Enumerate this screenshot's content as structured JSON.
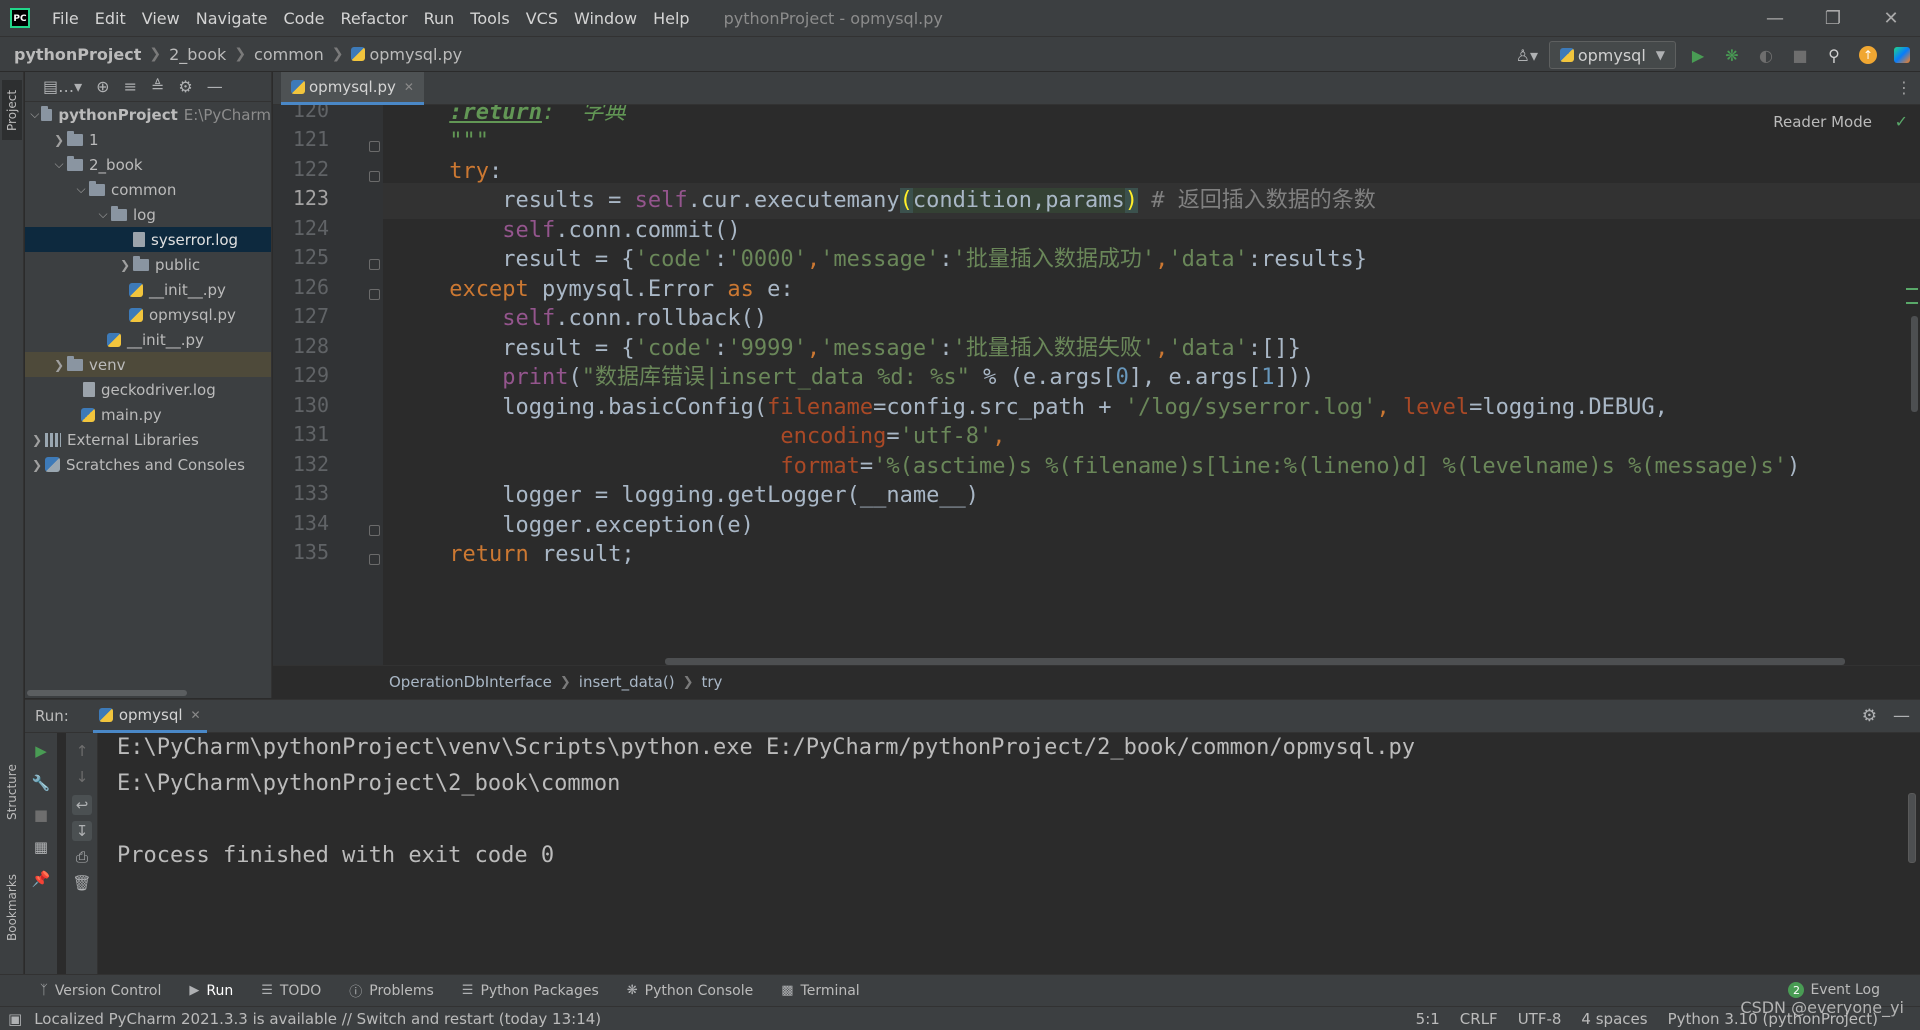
{
  "menu": {
    "items": [
      "File",
      "Edit",
      "View",
      "Navigate",
      "Code",
      "Refactor",
      "Run",
      "Tools",
      "VCS",
      "Window",
      "Help"
    ],
    "window_title": "pythonProject - opmysql.py"
  },
  "navbar": {
    "crumbs": [
      "pythonProject",
      "2_book",
      "common",
      "opmysql.py"
    ],
    "run_config": "opmysql"
  },
  "sidebar_tabs": {
    "project": "Project",
    "structure": "Structure",
    "bookmarks": "Bookmarks"
  },
  "project": {
    "root_name": "pythonProject",
    "root_path": "E:\\PyCharm",
    "items": [
      "1",
      "2_book",
      "common",
      "log",
      "syserror.log",
      "public",
      "__init__.py",
      "opmysql.py",
      "__init__.py",
      "venv",
      "geckodriver.log",
      "main.py",
      "External Libraries",
      "Scratches and Consoles"
    ]
  },
  "editor": {
    "tab_label": "opmysql.py",
    "reader_mode": "Reader Mode",
    "line_numbers": [
      "120",
      "121",
      "122",
      "123",
      "124",
      "125",
      "126",
      "127",
      "128",
      "129",
      "130",
      "131",
      "132",
      "133",
      "134",
      "135"
    ],
    "breadcrumb": [
      "OperationDbInterface",
      "insert_data()",
      "try"
    ],
    "code": {
      "l120_tag": ":return",
      "l120_text": ":  字典",
      "l121": "\"\"\"",
      "l122_kw": "try",
      "l122_p": ":",
      "l123_a": "results = ",
      "l123_self": "self",
      "l123_b": ".cur.executemany",
      "l123_open": "(",
      "l123_args": "condition,params",
      "l123_close": ")",
      "l123_cmt": " # 返回插入数据的条数",
      "l124_self": "self",
      "l124_b": ".conn.commit()",
      "l125_a": "result = {",
      "l125_k1": "'code'",
      "l125_c1": ":",
      "l125_v1": "'0000'",
      "l125_c2": ",",
      "l125_k2": "'message'",
      "l125_c3": ":",
      "l125_v2": "'批量插入数据成功'",
      "l125_c4": ",",
      "l125_k3": "'data'",
      "l125_c5": ":results}",
      "l126_kw": "except",
      "l126_b": " pymysql.Error ",
      "l126_as": "as",
      "l126_c": " e:",
      "l127_self": "self",
      "l127_b": ".conn.rollback()",
      "l128_a": "result = {",
      "l128_k1": "'code'",
      "l128_c1": ":",
      "l128_v1": "'9999'",
      "l128_c2": ",",
      "l128_k2": "'message'",
      "l128_c3": ":",
      "l128_v2": "'批量插入数据失败'",
      "l128_c4": ",",
      "l128_k3": "'data'",
      "l128_c5": ":[]}",
      "l129_print": "print",
      "l129_open": "(",
      "l129_str": "\"数据库错误|insert_data %d: %s\"",
      "l129_b": " % (e.args[",
      "l129_n0": "0",
      "l129_c": "], e.args[",
      "l129_n1": "1",
      "l129_d": "]))",
      "l130_a": "logging.basicConfig(",
      "l130_kw1": "filename",
      "l130_b": "=config.src_path + ",
      "l130_s1": "'/log/syserror.log'",
      "l130_c": ", ",
      "l130_kw2": "level",
      "l130_d": "=logging.DEBUG,",
      "l131_kw": "encoding",
      "l131_eq": "=",
      "l131_s": "'utf-8'",
      "l131_c": ",",
      "l132_kw": "format",
      "l132_eq": "=",
      "l132_s": "'%(asctime)s %(filename)s[line:%(lineno)d] %(levelname)s %(message)s'",
      "l132_c": ")",
      "l133": "logger = logging.getLogger(__name__)",
      "l134": "logger.exception(e)",
      "l135_kw": "return",
      "l135_b": " result;"
    }
  },
  "run": {
    "label": "Run:",
    "tab": "opmysql",
    "console": [
      "E:\\PyCharm\\pythonProject\\venv\\Scripts\\python.exe E:/PyCharm/pythonProject/2_book/common/opmysql.py",
      "E:\\PyCharm\\pythonProject\\2_book\\common",
      "Process finished with exit code 0"
    ]
  },
  "toolwindows": [
    "Version Control",
    "Run",
    "TODO",
    "Problems",
    "Python Packages",
    "Python Console",
    "Terminal"
  ],
  "event_log": {
    "label": "Event Log",
    "count": "2"
  },
  "status": {
    "message": "Localized PyCharm 2021.3.3 is available // Switch and restart (today 13:14)",
    "position": "5:1",
    "line_sep": "CRLF",
    "encoding": "UTF-8",
    "indent": "4 spaces",
    "interpreter": "Python 3.10 (pythonProject)"
  },
  "watermark": "CSDN @everyone_yi",
  "colors": {
    "background": "#2b2b2b",
    "panel": "#3c3f41",
    "keyword": "#cc7832",
    "string": "#6a8759",
    "number": "#6897bb",
    "self": "#94558d",
    "selection": "#0d293e",
    "accent": "#4a88c7"
  }
}
